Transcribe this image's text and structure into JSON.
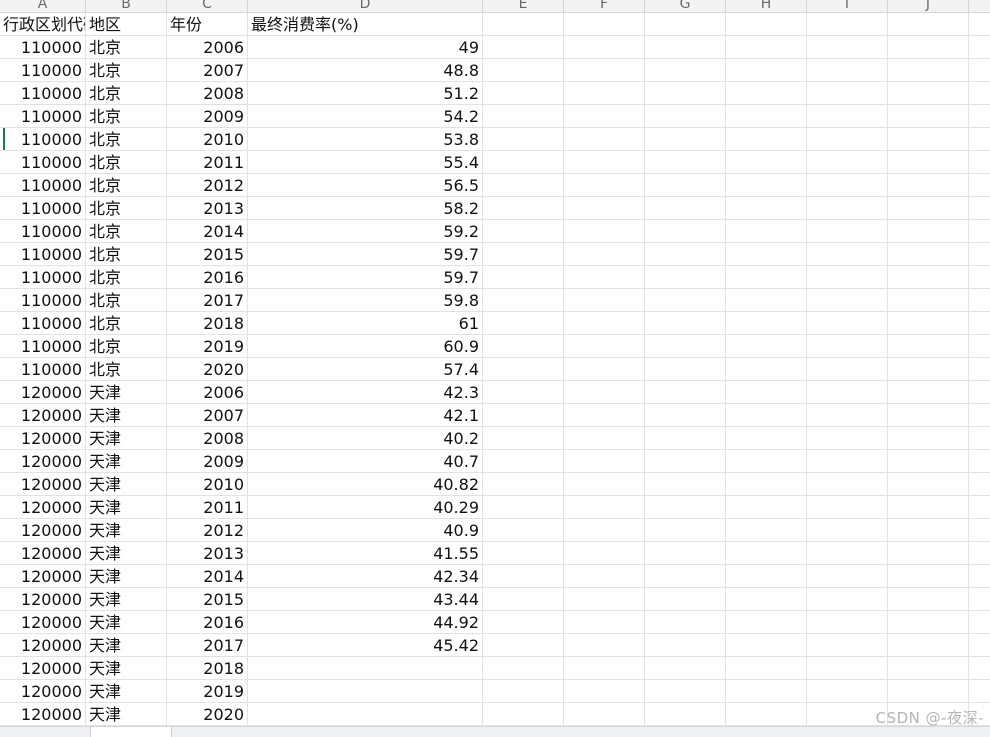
{
  "columns": [
    "A",
    "B",
    "C",
    "D",
    "E",
    "F",
    "G",
    "H",
    "I",
    "J"
  ],
  "headers": [
    "行政区划代码",
    "地区",
    "年份",
    "最终消费率(%)"
  ],
  "rows": [
    [
      "110000",
      "北京",
      "2006",
      "49"
    ],
    [
      "110000",
      "北京",
      "2007",
      "48.8"
    ],
    [
      "110000",
      "北京",
      "2008",
      "51.2"
    ],
    [
      "110000",
      "北京",
      "2009",
      "54.2"
    ],
    [
      "110000",
      "北京",
      "2010",
      "53.8"
    ],
    [
      "110000",
      "北京",
      "2011",
      "55.4"
    ],
    [
      "110000",
      "北京",
      "2012",
      "56.5"
    ],
    [
      "110000",
      "北京",
      "2013",
      "58.2"
    ],
    [
      "110000",
      "北京",
      "2014",
      "59.2"
    ],
    [
      "110000",
      "北京",
      "2015",
      "59.7"
    ],
    [
      "110000",
      "北京",
      "2016",
      "59.7"
    ],
    [
      "110000",
      "北京",
      "2017",
      "59.8"
    ],
    [
      "110000",
      "北京",
      "2018",
      "61"
    ],
    [
      "110000",
      "北京",
      "2019",
      "60.9"
    ],
    [
      "110000",
      "北京",
      "2020",
      "57.4"
    ],
    [
      "120000",
      "天津",
      "2006",
      "42.3"
    ],
    [
      "120000",
      "天津",
      "2007",
      "42.1"
    ],
    [
      "120000",
      "天津",
      "2008",
      "40.2"
    ],
    [
      "120000",
      "天津",
      "2009",
      "40.7"
    ],
    [
      "120000",
      "天津",
      "2010",
      "40.82"
    ],
    [
      "120000",
      "天津",
      "2011",
      "40.29"
    ],
    [
      "120000",
      "天津",
      "2012",
      "40.9"
    ],
    [
      "120000",
      "天津",
      "2013",
      "41.55"
    ],
    [
      "120000",
      "天津",
      "2014",
      "42.34"
    ],
    [
      "120000",
      "天津",
      "2015",
      "43.44"
    ],
    [
      "120000",
      "天津",
      "2016",
      "44.92"
    ],
    [
      "120000",
      "天津",
      "2017",
      "45.42"
    ],
    [
      "120000",
      "天津",
      "2018",
      ""
    ],
    [
      "120000",
      "天津",
      "2019",
      ""
    ],
    [
      "120000",
      "天津",
      "2020",
      ""
    ]
  ],
  "watermark": "CSDN @-夜深-",
  "colors": {
    "header_bg": "#f3f3f3",
    "gridline": "#e2e2e2",
    "selection": "#1f7a4d"
  }
}
